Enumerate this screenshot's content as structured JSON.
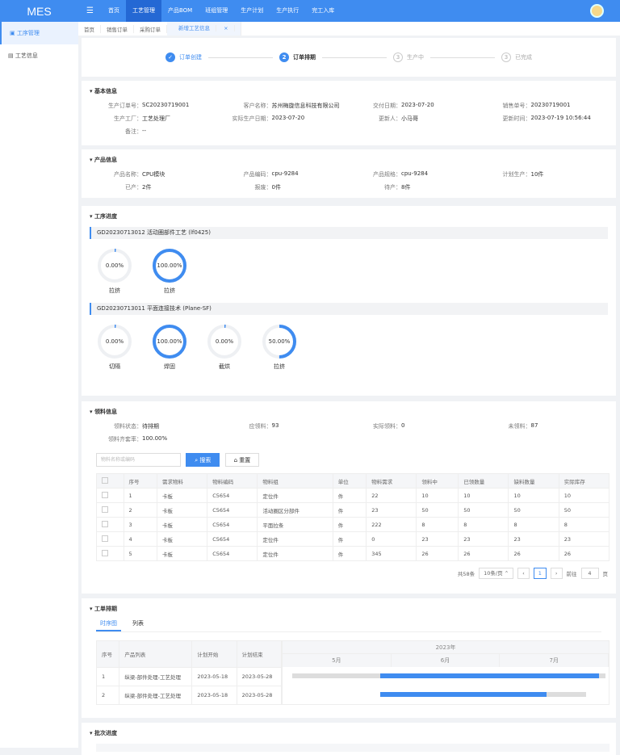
{
  "header": {
    "logo": "MES",
    "nav": [
      "首页",
      "工艺管理",
      "产品BOM",
      "班组管理",
      "生产计划",
      "生产执行",
      "完工入库"
    ],
    "active_nav": 1
  },
  "sidebar": {
    "items": [
      "工序管理",
      "工艺信息"
    ]
  },
  "tabs": [
    "首页",
    "销售订单",
    "采购订单",
    "新增工艺信息"
  ],
  "steps": [
    {
      "num": "✓",
      "label": "订单创建"
    },
    {
      "num": "2",
      "label": "订单排期"
    },
    {
      "num": "3",
      "label": "生产中"
    },
    {
      "num": "3",
      "label": "已完成"
    }
  ],
  "basic": {
    "title": "基本信息",
    "fields": [
      [
        "生产订单号：",
        "SC20230719001"
      ],
      [
        "客户名称：",
        "苏州梅旋信息科技有限公司"
      ],
      [
        "交付日期：",
        "2023-07-20"
      ],
      [
        "销售单号：",
        "20230719001"
      ],
      [
        "生产工厂：",
        "工艺处理厂"
      ],
      [
        "实际生产日期：",
        "2023-07-20"
      ],
      [
        "更新人：",
        "小马哥"
      ],
      [
        "更新时间：",
        "2023-07-19 10:56:44"
      ],
      [
        "备注：",
        "--"
      ]
    ]
  },
  "product": {
    "title": "产品信息",
    "fields": [
      [
        "产品名称：",
        "CPU模块"
      ],
      [
        "产品编码：",
        "cpu-9284"
      ],
      [
        "产品规格：",
        "cpu-9284"
      ],
      [
        "计划生产：",
        "10件"
      ],
      [
        "已产：",
        "2件"
      ],
      [
        "报废：",
        "0件"
      ],
      [
        "待产：",
        "8件"
      ]
    ]
  },
  "process": {
    "title": "工序进度",
    "groups": [
      {
        "header": "GD20230713012    活动圈部件工艺      (lf0425)",
        "items": [
          {
            "pct": 0,
            "text": "0.00%",
            "label": "拉挤"
          },
          {
            "pct": 100,
            "text": "100.00%",
            "label": "拉挤"
          }
        ]
      },
      {
        "header": "GD20230713011    平面连接技术      (Plane-SF)",
        "items": [
          {
            "pct": 0,
            "text": "0.00%",
            "label": "切隔"
          },
          {
            "pct": 100,
            "text": "100.00%",
            "label": "焊固"
          },
          {
            "pct": 0,
            "text": "0.00%",
            "label": "截烘"
          },
          {
            "pct": 50,
            "text": "50.00%",
            "label": "拉挤"
          }
        ]
      }
    ]
  },
  "material": {
    "title": "领料信息",
    "fields": [
      [
        "领料状态：",
        "待排期"
      ],
      [
        "应领料：",
        "93"
      ],
      [
        "实际领料：",
        "0"
      ],
      [
        "未领料：",
        "87"
      ],
      [
        "领料齐套率：",
        "100.00%"
      ]
    ],
    "search_placeholder": "物料名称或编码",
    "search_label": "搜索",
    "reset_label": "重置",
    "columns": [
      "序号",
      "需求物料",
      "物料编码",
      "物料组",
      "单位",
      "物料需求",
      "领料中",
      "已领数量",
      "缺料数量",
      "实际库存"
    ],
    "rows": [
      [
        "1",
        "卡板",
        "C5654",
        "定位件",
        "件",
        "22",
        "10",
        "10",
        "10",
        "10"
      ],
      [
        "2",
        "卡板",
        "C5654",
        "活动圈区分部件",
        "件",
        "23",
        "50",
        "50",
        "50",
        "50"
      ],
      [
        "3",
        "卡板",
        "C5654",
        "平面拉条",
        "件",
        "222",
        "8",
        "8",
        "8",
        "8"
      ],
      [
        "4",
        "卡板",
        "C5654",
        "定位件",
        "件",
        "0",
        "23",
        "23",
        "23",
        "23"
      ],
      [
        "5",
        "卡板",
        "C5654",
        "定位件",
        "件",
        "345",
        "26",
        "26",
        "26",
        "26"
      ]
    ],
    "pagination": {
      "total": "共58条",
      "size": "10条/页",
      "page": "1",
      "goto_label": "前往",
      "goto": "4",
      "suffix": "页"
    }
  },
  "schedule": {
    "title": "工单排期",
    "tabs": [
      "时序图",
      "列表"
    ],
    "columns": [
      "序号",
      "产品列表",
      "计划开始",
      "计划结束"
    ],
    "year": "2023年",
    "months": [
      "5月",
      "6月",
      "7月"
    ],
    "rows": [
      {
        "cells": [
          "1",
          "纵梁-部件处理-工艺处理",
          "2023-05-18",
          "2023-05-28"
        ],
        "grey": [
          0.03,
          0.99
        ],
        "blue": [
          0.3,
          0.97
        ]
      },
      {
        "cells": [
          "2",
          "纵梁-部件处理-工艺处理",
          "2023-05-18",
          "2023-05-28"
        ],
        "grey": [
          0.3,
          0.93
        ],
        "blue": [
          0.3,
          0.81
        ]
      }
    ]
  },
  "batch": {
    "title": "批次进度"
  }
}
